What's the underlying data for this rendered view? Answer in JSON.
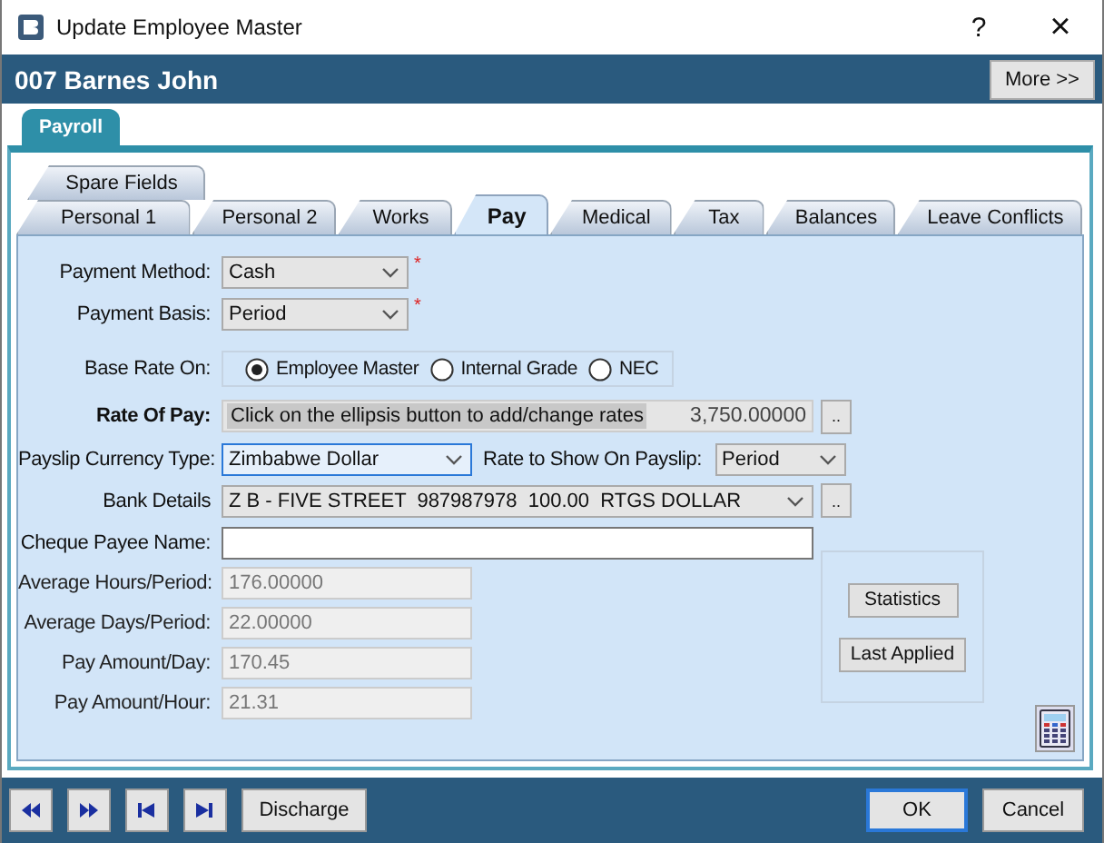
{
  "window": {
    "title": "Update Employee Master",
    "controls": [
      {
        "kind": "help",
        "label": "?"
      },
      {
        "kind": "close",
        "label": "×"
      }
    ]
  },
  "header": {
    "name": "007 Barnes John",
    "more_button": "More >>"
  },
  "main_tabs": [
    {
      "label": "Payroll",
      "selected": true
    }
  ],
  "tab_rows": [
    [
      {
        "label": "Spare Fields",
        "selected": false
      }
    ],
    [
      {
        "label": "Personal 1",
        "selected": false
      },
      {
        "label": "Personal 2",
        "selected": false
      },
      {
        "label": "Works",
        "selected": false
      },
      {
        "label": "Pay",
        "selected": true
      },
      {
        "label": "Medical",
        "selected": false
      },
      {
        "label": "Tax",
        "selected": false
      },
      {
        "label": "Balances",
        "selected": false
      },
      {
        "label": "Leave Conflicts",
        "selected": false
      }
    ]
  ],
  "fields": [
    {
      "kind": "dropdown",
      "label": "Payment Method:",
      "value": "Cash",
      "required_mark": "*"
    },
    {
      "kind": "dropdown",
      "label": "Payment Basis:",
      "value": "Period",
      "required_mark": "*"
    },
    {
      "kind": "radio",
      "label": "Base Rate On:",
      "options": [
        {
          "label": "Employee Master",
          "selected": true
        },
        {
          "label": "Internal Grade",
          "selected": false
        },
        {
          "label": "NEC",
          "selected": false
        }
      ]
    },
    {
      "kind": "rate",
      "label": "Rate Of Pay:",
      "hint": "Click on the ellipsis button to add/change rates",
      "value": "3,750.00000",
      "button": ".."
    },
    {
      "kind": "currency",
      "label": "Payslip Currency Type:",
      "value": "Zimbabwe Dollar",
      "focused": true,
      "rate_label": "Rate to Show On Payslip:",
      "rate_value": "Period"
    },
    {
      "kind": "bank",
      "label": "Bank Details",
      "value": "Z B - FIVE STREET  987987978  100.00  RTGS DOLLAR",
      "button": ".."
    },
    {
      "kind": "text",
      "label": "Cheque Payee Name:"
    }
  ],
  "readonly_fields": [
    {
      "label": "Average Hours/Period:",
      "value": "176.00000",
      "disabled": true
    },
    {
      "label": "Average Days/Period:",
      "value": "22.00000",
      "disabled": true
    },
    {
      "label": "Pay Amount/Day:",
      "value": "170.45",
      "disabled": true
    },
    {
      "label": "Pay Amount/Hour:",
      "value": "21.31",
      "disabled": true
    }
  ],
  "side_buttons": [
    "Statistics",
    "Last Applied"
  ],
  "nav_buttons": [
    {
      "kind": "rewind"
    },
    {
      "kind": "forward"
    },
    {
      "kind": "first"
    },
    {
      "kind": "last"
    }
  ],
  "footer_buttons": [
    {
      "label": "Discharge",
      "default": false
    },
    {
      "label": "OK",
      "default": true
    },
    {
      "label": "Cancel",
      "default": false
    }
  ]
}
